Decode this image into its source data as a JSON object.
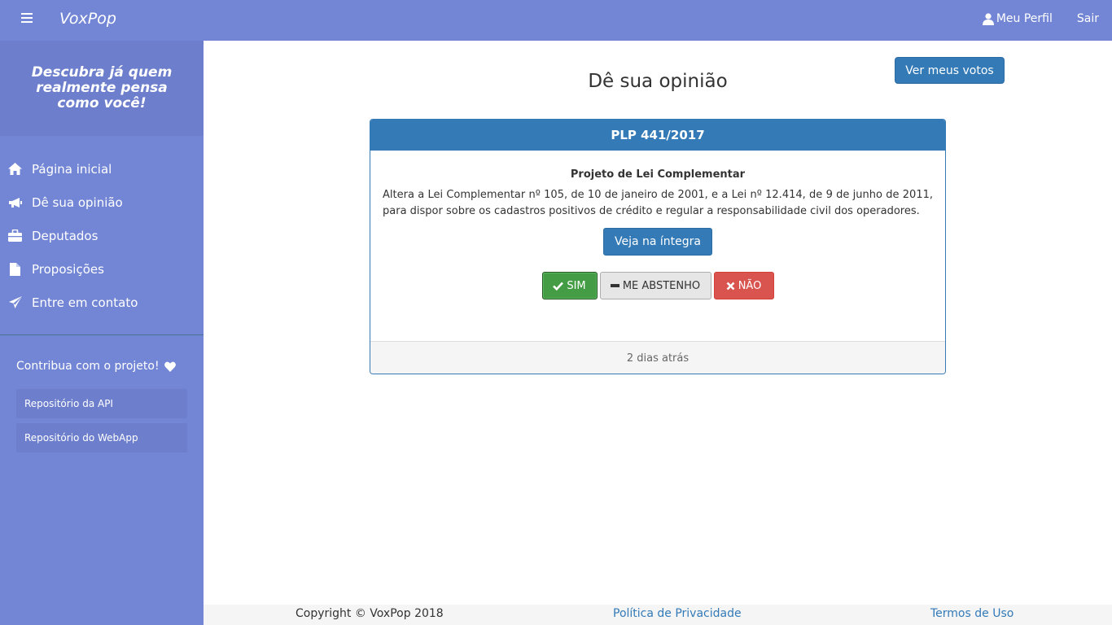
{
  "navbar": {
    "brand": "VoxPop",
    "profile_label": "Meu Perfil",
    "logout_label": "Sair"
  },
  "sidebar": {
    "tagline": "Descubra já quem realmente pensa como você!",
    "items": [
      {
        "label": "Página inicial",
        "icon": "home-icon"
      },
      {
        "label": "Dê sua opinião",
        "icon": "bullhorn-icon"
      },
      {
        "label": "Deputados",
        "icon": "briefcase-icon"
      },
      {
        "label": "Proposições",
        "icon": "file-icon"
      },
      {
        "label": "Entre em contato",
        "icon": "send-icon"
      }
    ],
    "contribute_title": "Contribua com o projeto!",
    "repos": [
      "Repositório da API",
      "Repositório do WebApp"
    ]
  },
  "main": {
    "title": "Dê sua opinião",
    "my_votes_button": "Ver meus votos"
  },
  "proposal": {
    "code": "PLP 441/2017",
    "type": "Projeto de Lei Complementar",
    "summary": "Altera a Lei Complementar nº 105, de 10 de janeiro de 2001, e a Lei nº 12.414, de 9 de junho de 2011, para dispor sobre os cadastros positivos de crédito e regular a responsabilidade civil dos operadores.",
    "full_text_button": "Veja na íntegra",
    "vote_yes": "SIM",
    "vote_abstain": "ME ABSTENHO",
    "vote_no": "NÃO",
    "time_ago": "2 dias atrás"
  },
  "footer": {
    "copyright": "Copyright © VoxPop 2018",
    "privacy": "Política de Privacidade",
    "terms": "Termos de Uso"
  },
  "colors": {
    "primary": "#7386d5",
    "sidebar_header": "#6d7fcc",
    "panel_blue": "#337ab7",
    "yes_green": "#449d44",
    "no_red": "#d9534f"
  }
}
